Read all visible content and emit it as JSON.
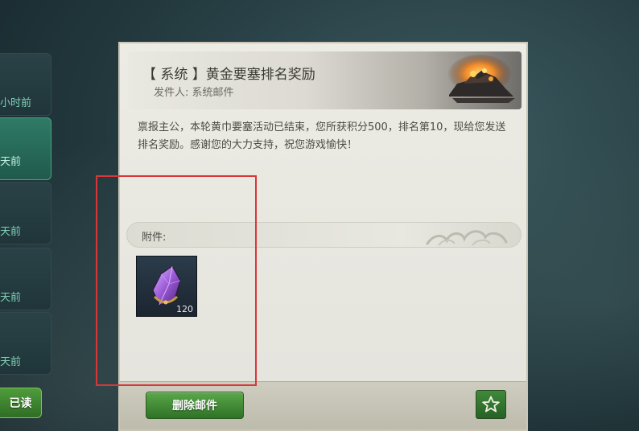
{
  "mail_list": {
    "items": [
      {
        "time": "小时前",
        "selected": false
      },
      {
        "time": "天前",
        "selected": true
      },
      {
        "time": "天前",
        "selected": false
      },
      {
        "time": "天前",
        "selected": false
      },
      {
        "time": "天前",
        "selected": false
      }
    ],
    "read_all_label": "已读"
  },
  "mail": {
    "title": "【 系统 】黄金要塞排名奖励",
    "sender_label": "发件人:",
    "sender": "系统邮件",
    "body": "禀报主公，本轮黄巾要塞活动已结束，您所获积分500，排名第10，现给您发送排名奖励。感谢您的大力支持，祝您游戏愉快！",
    "attachments_label": "附件:",
    "attachments": [
      {
        "icon": "purple-crystal-icon",
        "count": "120"
      }
    ]
  },
  "footer": {
    "delete_label": "删除邮件",
    "star_icon": "star-icon"
  },
  "colors": {
    "accent_green": "#3f8a3a",
    "highlight_red": "#d8373a",
    "selected_item": "#2f7a66"
  }
}
